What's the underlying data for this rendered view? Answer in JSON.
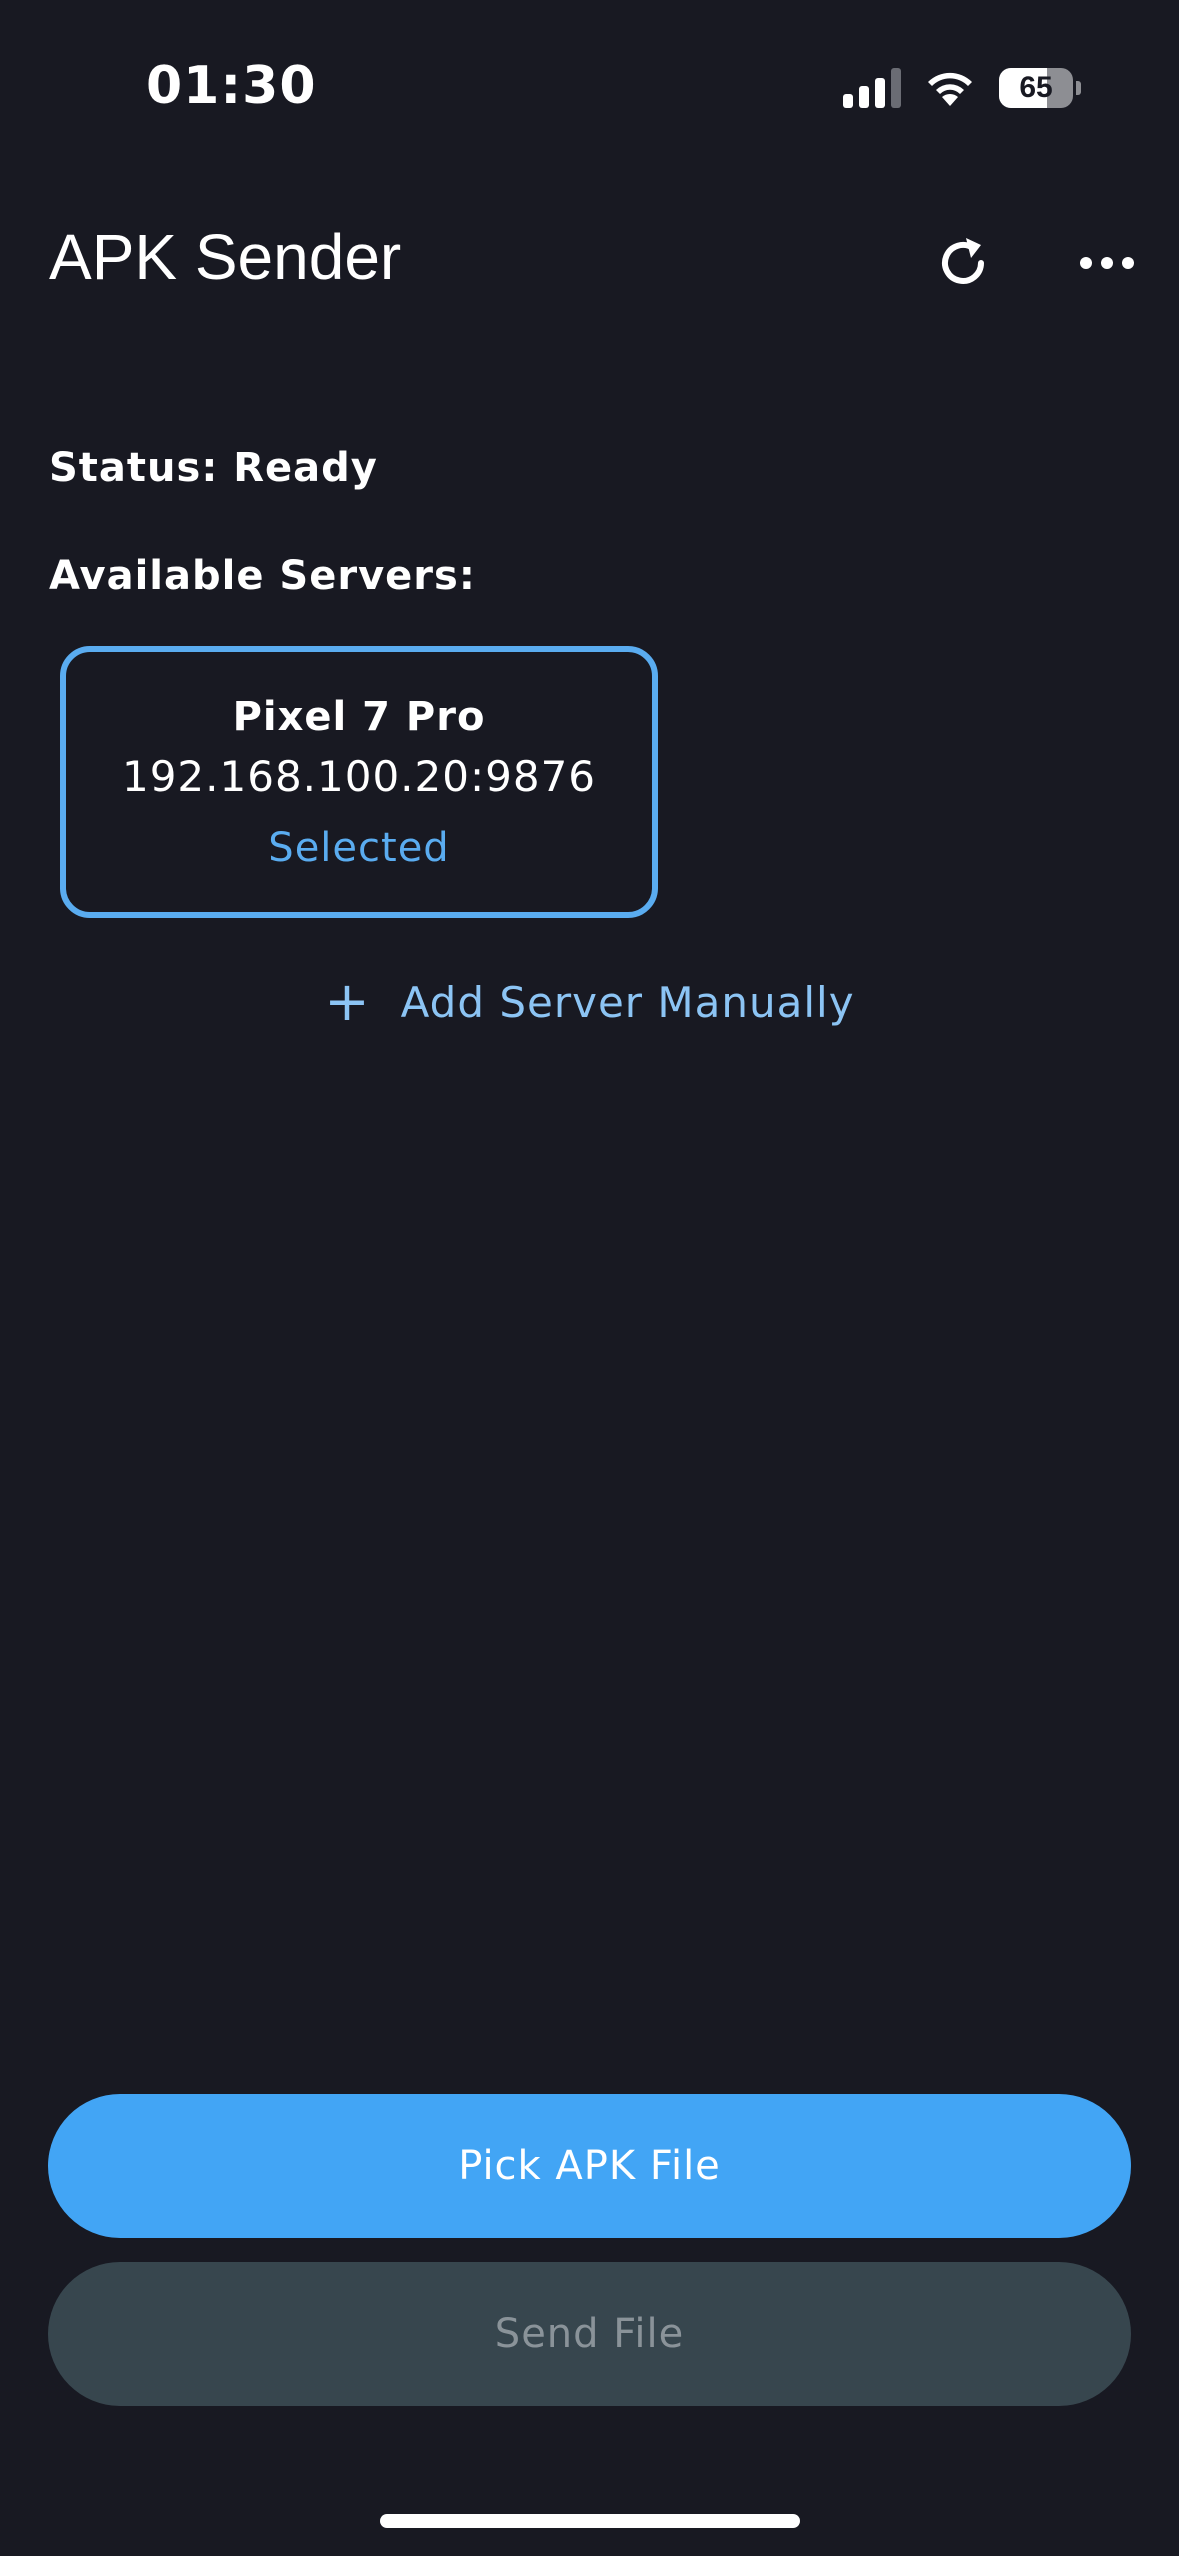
{
  "status_bar": {
    "time": "01:30",
    "battery_level": "65",
    "signal_bars_active": 3,
    "signal_bars_total": 4
  },
  "app_bar": {
    "title": "APK Sender",
    "actions": [
      {
        "icon": "refresh-icon"
      },
      {
        "icon": "more-horizontal-icon"
      }
    ]
  },
  "main": {
    "status_text": "Status: Ready",
    "servers_label": "Available Servers:",
    "servers": [
      {
        "name": "Pixel 7 Pro",
        "address": "192.168.100.20:9876",
        "state": "Selected"
      }
    ],
    "add_server_label": "Add Server Manually",
    "add_server_icon": "+"
  },
  "buttons": {
    "pick_label": "Pick APK File",
    "send_label": "Send File"
  },
  "colors": {
    "background": "#181922",
    "accent": "#42a5f5",
    "selected_border": "#5aacf0",
    "disabled_button": "#37464e"
  }
}
